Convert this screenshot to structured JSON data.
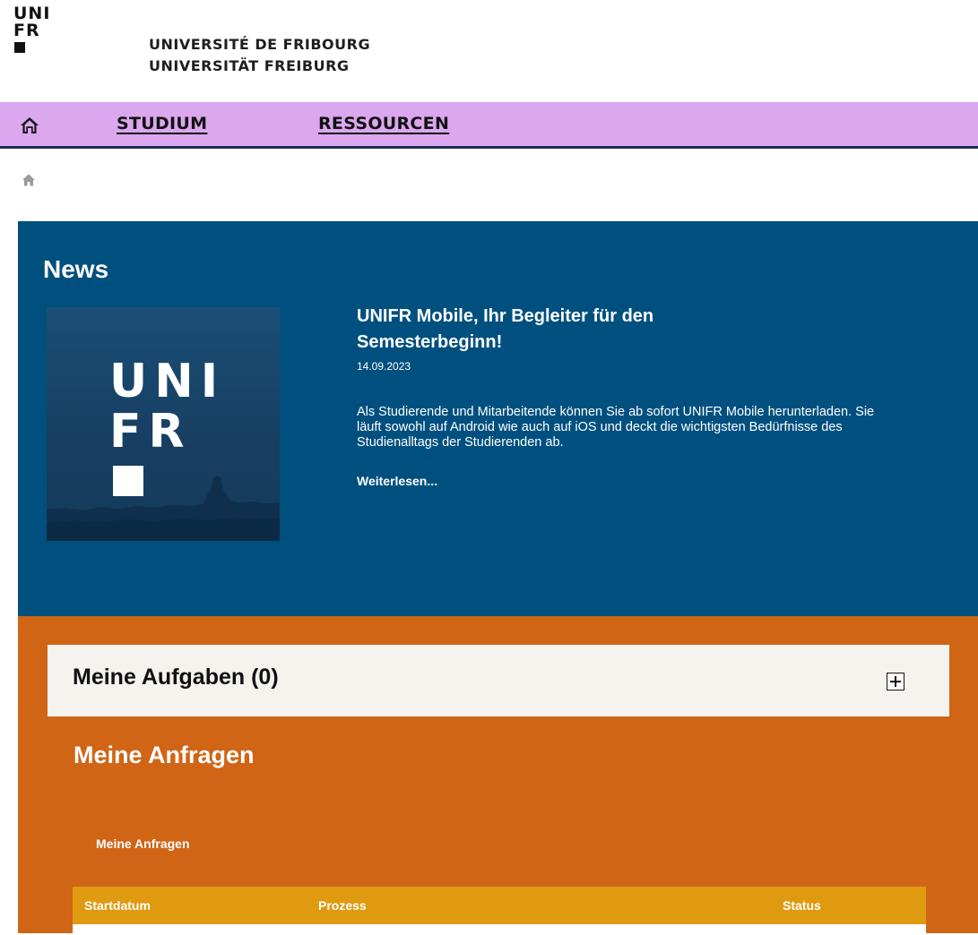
{
  "header": {
    "logo_lines": [
      "UNI",
      "FR"
    ],
    "name_fr": "UNIVERSITÉ DE FRIBOURG",
    "name_de": "UNIVERSITÄT FREIBURG"
  },
  "nav": {
    "home_icon": "home-icon",
    "items": [
      {
        "label": "STUDIUM"
      },
      {
        "label": "RESSOURCEN"
      }
    ]
  },
  "breadcrumb": {
    "home_icon": "home-icon"
  },
  "news": {
    "title": "News",
    "image_logo_lines": [
      "UNI",
      "FR"
    ],
    "headline": "UNIFR Mobile, Ihr Begleiter für den Semesterbeginn!",
    "date": "14.09.2023",
    "body": "Als Studierende und Mitarbeitende können Sie ab sofort UNIFR Mobile herunterladen. Sie läuft sowohl auf Android wie auch auf iOS und deckt die wichtigsten Bedürfnisse des Studienalltags der Studierenden ab.",
    "more": "Weiterlesen..."
  },
  "tasks": {
    "title": "Meine Aufgaben (0)",
    "toggle_icon": "plus-box-icon"
  },
  "requests": {
    "title": "Meine Anfragen",
    "subtitle": "Meine Anfragen",
    "columns": [
      "Startdatum",
      "Prozess",
      "Status"
    ]
  },
  "colors": {
    "nav_bg": "#dba7ee",
    "nav_border": "#1f2e52",
    "news_bg": "#00507f",
    "tasks_bg": "#d06516",
    "table_header_bg": "#df9a10",
    "panel_bg": "#f6f3ef"
  }
}
